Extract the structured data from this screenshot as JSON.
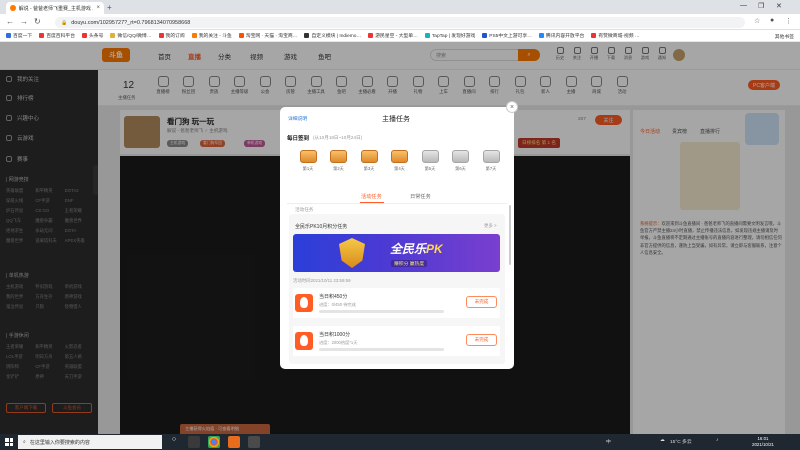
{
  "browser": {
    "tab_title": "解说 - 爸爸老师飞重赛_主机游戏 ...",
    "url": "douyu.com/10295727?_rt=0.7968134070958668",
    "bookmarks": [
      "百度一下",
      "百度百科平台",
      "头条号",
      "微信/QQ/微博…",
      "我的订阅",
      "我的关注 - 斗鱼",
      "淘宝网 · 天猫 · 淘宝商…",
      "自定义模块 | Indiemo…",
      "游民星空 - 大型单…",
      "TapTap | 发现好游戏",
      "PS5中文上游可享…",
      "腾讯内容开放平台",
      "有赞微商城-视频 …"
    ],
    "bookmarks_right": "其他书签"
  },
  "douyu": {
    "logo": "斗鱼",
    "nav": [
      "首页",
      "直播",
      "分类",
      "视频",
      "游戏",
      "鱼吧"
    ],
    "nav_active": "直播",
    "search_placeholder": "搜索",
    "header_icons": [
      "历史",
      "关注",
      "开播",
      "下载",
      "消息",
      "游戏",
      "通知"
    ]
  },
  "sidebar": {
    "main": [
      "我的关注",
      "排行榜",
      "兴趣中心",
      "云游戏",
      "赛事"
    ],
    "sections": [
      {
        "title": "| 网游竞技",
        "items": [
          "英雄联盟",
          "和平精英",
          "DOTA2",
          "穿越火线",
          "CF手游",
          "DNF",
          "炉石传说",
          "CS:GO",
          "王者荣耀",
          "QQ飞车",
          "魔兽争霸",
          "魔兽世界",
          "绝地求生",
          "永劫无间",
          "DOTA",
          "魔兽世界",
          "逃离塔科夫",
          "APEX英雄"
        ]
      },
      {
        "title": "| 单机热游",
        "items": [
          "主机游戏",
          "怀旧游戏",
          "单机游戏",
          "我的世界",
          "方舟生存",
          "原神游戏",
          "鬼泣传说",
          "只狼",
          "怪物猎人"
        ]
      },
      {
        "title": "| 手游休闲",
        "items": [
          "王者荣耀",
          "和平精英",
          "火影忍者",
          "LOL手游",
          "明日方舟",
          "第五人格",
          "阴阳师",
          "CF手游",
          "英雄联盟",
          "金铲铲",
          "原神",
          "天刀手游"
        ]
      }
    ],
    "btn_left": "客户端下载",
    "btn_right": "斗鱼会员"
  },
  "category_bar": {
    "day_count": "12",
    "day_label": "主播任务",
    "items": [
      "直播榜",
      "粉丝团",
      "贵族",
      "主播等级",
      "公会",
      "房管",
      "主播工具",
      "鱼吧",
      "主播必看",
      "开播",
      "礼物",
      "上车",
      "直播间",
      "排行",
      "礼包",
      "新人",
      "主播",
      "商城",
      "活动"
    ],
    "pc_button": "PC客户端"
  },
  "room": {
    "title": "看门狗 玩一玩",
    "meta": "解说 - 爸爸老师飞 ♂ 主机游戏",
    "tags": [
      "主机游戏",
      "看门狗军团",
      "单机游戏"
    ],
    "rank": "日榜排名 第 1 名",
    "fans": "207",
    "follow": "关注"
  },
  "right_panel": {
    "tabs": [
      "今日活动",
      "贵宾榜",
      "直播排行"
    ],
    "message_sys": "系统提示：",
    "message": "欢迎来到斗鱼直播间 · 爸爸老师飞的直播间需要文明发言哦，斗鱼官方严禁主播24小时直播，禁止传播违法信息，如发现违规主播请及时举报，斗鱼直播将不定期通过主播账号的直播内容进行整理，请勿相信任何非官方提供的信息，谨防上当受骗，如有异常，请立即与客服联系，注意个人信息安全。"
  },
  "modal": {
    "header_link": "详细说明",
    "title": "主播任务",
    "signin_title": "每日签到",
    "signin_range": "(从10月18日~10月24日)",
    "days": [
      {
        "label": "第1天",
        "done": true
      },
      {
        "label": "第2天",
        "done": true
      },
      {
        "label": "第3天",
        "done": true
      },
      {
        "label": "第4天",
        "done": true
      },
      {
        "label": "第5天",
        "done": false
      },
      {
        "label": "第6天",
        "done": false
      },
      {
        "label": "第7天",
        "done": false
      }
    ],
    "tabs": [
      "活动任务",
      "日常任务"
    ],
    "tab_active": "活动任务",
    "subtitle": "活动任务",
    "task_group_title": "全民乐PK10月积分任务",
    "task_group_more": "更多 >",
    "banner_title_a": "全民乐",
    "banner_title_b": "PK",
    "banner_sub": "赚积分 赢热度",
    "banner_time": "活动时间2021/10/11 23:59:59",
    "tasks": [
      {
        "name": "当日积450分",
        "progress_text": "进度：0/450 待完成",
        "progress": 0.0,
        "button": "未完成"
      },
      {
        "name": "当日积1000分",
        "progress_text": "进度：2000热度*1天",
        "progress": 0.0,
        "button": "未完成"
      }
    ]
  },
  "toast": "主播获得火焰值 · 可查看明细",
  "taskbar": {
    "search_placeholder": "在这里输入你要搜索的内容",
    "weather": "15°C 多云",
    "time": "16:01",
    "date": "2021/10/21",
    "lang": "中"
  },
  "colors": {
    "accent": "#ff5d23",
    "douyu_orange": "#ff7a00",
    "sidebar_bg": "#2d2d2d",
    "banner_start": "#2a3fd8",
    "banner_end": "#7a3fcf"
  }
}
